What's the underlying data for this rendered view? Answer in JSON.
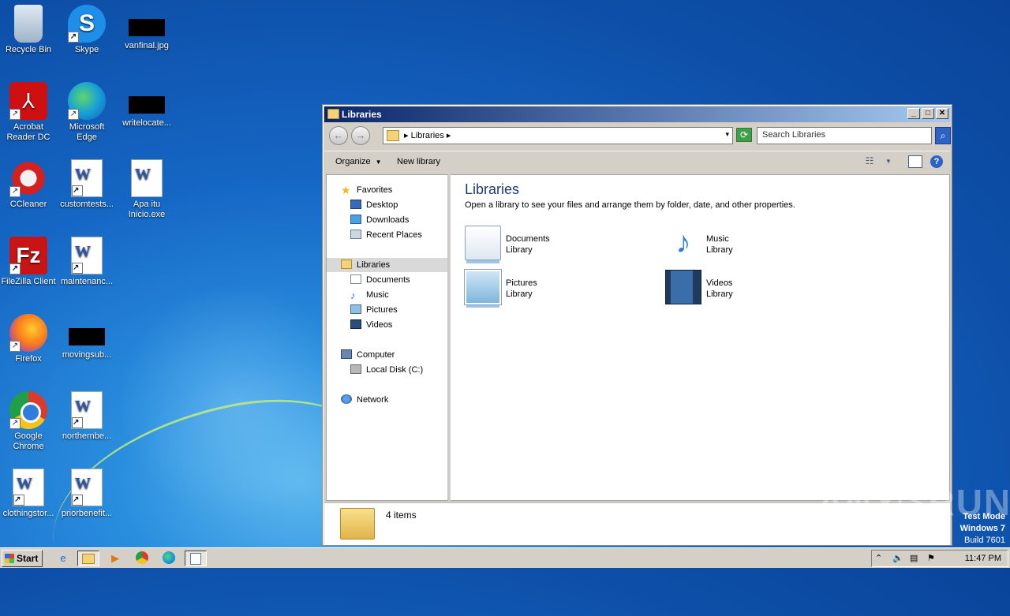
{
  "desktop": {
    "icons": [
      {
        "label": "Recycle Bin",
        "icon": "recycle-bin-icon"
      },
      {
        "label": "Skype",
        "icon": "skype-icon"
      },
      {
        "label": "vanfinal.jpg",
        "icon": "image-file-icon"
      },
      {
        "label": "Acrobat Reader DC",
        "icon": "acrobat-icon"
      },
      {
        "label": "Microsoft Edge",
        "icon": "edge-icon"
      },
      {
        "label": "writelocate...",
        "icon": "file-icon"
      },
      {
        "label": "CCleaner",
        "icon": "ccleaner-icon"
      },
      {
        "label": "customtests...",
        "icon": "word-doc-icon"
      },
      {
        "label": "Apa itu Inicio.exe",
        "icon": "word-doc-icon"
      },
      {
        "label": "FileZilla Client",
        "icon": "filezilla-icon"
      },
      {
        "label": "maintenanc...",
        "icon": "word-doc-icon"
      },
      {
        "label": "Firefox",
        "icon": "firefox-icon"
      },
      {
        "label": "movingsub...",
        "icon": "file-icon"
      },
      {
        "label": "Google Chrome",
        "icon": "chrome-icon"
      },
      {
        "label": "northernbe...",
        "icon": "word-doc-icon"
      },
      {
        "label": "clothingstor...",
        "icon": "word-doc-icon"
      },
      {
        "label": "priorbenefit...",
        "icon": "word-doc-icon"
      }
    ]
  },
  "window": {
    "title": "Libraries",
    "address": {
      "crumb": "Libraries",
      "dropdown_glyph": "▾"
    },
    "search": {
      "placeholder": "Search Libraries"
    },
    "toolbar": {
      "organize": "Organize",
      "new_library": "New library"
    },
    "nav": {
      "favorites": "Favorites",
      "desktop": "Desktop",
      "downloads": "Downloads",
      "recent_places": "Recent Places",
      "libraries": "Libraries",
      "documents": "Documents",
      "music": "Music",
      "pictures": "Pictures",
      "videos": "Videos",
      "computer": "Computer",
      "local_disk": "Local Disk (C:)",
      "network": "Network"
    },
    "content": {
      "title": "Libraries",
      "subtitle": "Open a library to see your files and arrange them by folder, date, and other properties.",
      "libraries": [
        {
          "name": "Documents",
          "type": "Library"
        },
        {
          "name": "Music",
          "type": "Library"
        },
        {
          "name": "Pictures",
          "type": "Library"
        },
        {
          "name": "Videos",
          "type": "Library"
        }
      ]
    },
    "status": {
      "count": "4 items"
    }
  },
  "watermark": {
    "text": "ANY▷RUN",
    "mode": "Test Mode",
    "os": "Windows 7",
    "build": "Build 7601"
  },
  "taskbar": {
    "start_label": "Start",
    "clock": "11:47 PM"
  },
  "colors": {
    "title_gradient_start": "#0a246a",
    "title_gradient_end": "#a6caf0",
    "desktop_blue": "#1566c4"
  }
}
